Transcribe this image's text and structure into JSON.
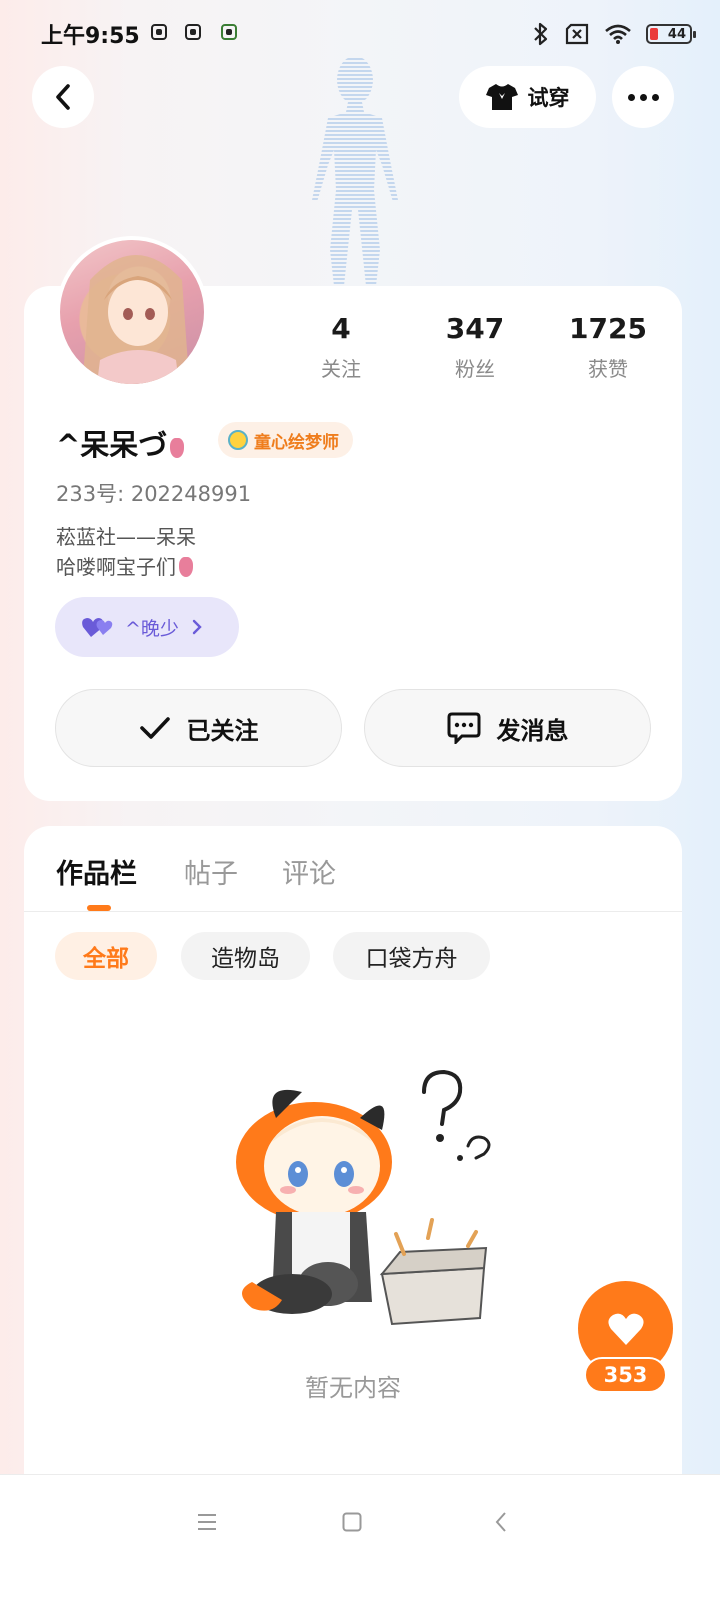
{
  "status_bar": {
    "time": "上午9:55",
    "battery": "44",
    "left_icons": [
      "app-notification-icon",
      "app-notification-icon",
      "app-notification-icon"
    ],
    "right_icons": [
      "bluetooth-icon",
      "sim-off-icon",
      "wifi-icon",
      "battery-icon"
    ]
  },
  "top_bar": {
    "back_icon": "chevron-left-icon",
    "try_on_label": "试穿",
    "try_on_icon": "tshirt-icon",
    "more_icon": "more-horizontal-icon"
  },
  "profile": {
    "nickname": "^呆呆づ",
    "badge_label": "童心绘梦师",
    "uid": "233号: 202248991",
    "bio_line1": "菘蓝社——呆呆",
    "bio_line2": "哈喽啊宝子们",
    "cp_tag_label": "^晚少",
    "stats": [
      {
        "value": "4",
        "label": "关注"
      },
      {
        "value": "347",
        "label": "粉丝"
      },
      {
        "value": "1725",
        "label": "获赞"
      }
    ],
    "follow_label": "已关注",
    "message_label": "发消息"
  },
  "tabs": [
    {
      "label": "作品栏",
      "active": true
    },
    {
      "label": "帖子",
      "active": false
    },
    {
      "label": "评论",
      "active": false
    }
  ],
  "filters": [
    {
      "label": "全部",
      "active": true
    },
    {
      "label": "造物岛",
      "active": false
    },
    {
      "label": "口袋方舟",
      "active": false
    }
  ],
  "empty_state": {
    "text": "暂无内容"
  },
  "like_button": {
    "count": "353"
  },
  "nav_bar": {
    "icons": [
      "menu-icon",
      "home-square-icon",
      "back-triangle-icon"
    ]
  },
  "colors": {
    "accent": "#ff7a1a",
    "cp_tag": "#6a5bd8",
    "badge_text": "#ef7d1d"
  }
}
